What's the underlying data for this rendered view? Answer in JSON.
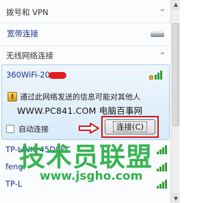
{
  "dialup_section": {
    "title": "拨号和 VPN",
    "chevron": "^"
  },
  "wired": {
    "label": "宽带连接",
    "icon": "drive-icon"
  },
  "wireless_section": {
    "title": "无线网络连接",
    "chevron": "^"
  },
  "selected_network": {
    "ssid": "360WiFi-20",
    "warning": "通过此网络发送的信息可能对其他人",
    "watermark": "WWW.PC841.COM 电脑百事网",
    "auto_connect_label": "自动连接",
    "auto_connect_checked": false,
    "connect_label": "连接(C)"
  },
  "networks": [
    {
      "ssid": "TP-LINK_45D0FC"
    },
    {
      "ssid": "fengl"
    },
    {
      "ssid": "TP-L"
    }
  ],
  "brand": {
    "text": "技术员联盟",
    "url": "www.jsgho.com",
    "color": "#2fb14a"
  },
  "colors": {
    "link": "#1e3287",
    "highlight_border": "#d3141b",
    "signal": "#2f9e32"
  }
}
